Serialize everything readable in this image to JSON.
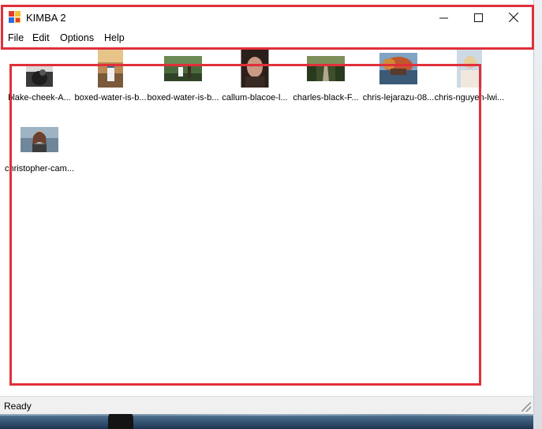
{
  "window": {
    "title": "KIMBA 2",
    "controls": {
      "minimize": "minimize-icon",
      "maximize": "maximize-icon",
      "close": "close-icon"
    }
  },
  "menu": {
    "items": [
      "File",
      "Edit",
      "Options",
      "Help"
    ]
  },
  "thumbnails": [
    {
      "caption": "blake-cheek-A..."
    },
    {
      "caption": "boxed-water-is-b..."
    },
    {
      "caption": "boxed-water-is-b..."
    },
    {
      "caption": "callum-blacoe-l..."
    },
    {
      "caption": "charles-black-F..."
    },
    {
      "caption": "chris-lejarazu-08..."
    },
    {
      "caption": "chris-nguyen-lwi..."
    },
    {
      "caption": "christopher-cam..."
    }
  ],
  "status": {
    "text": "Ready"
  },
  "colors": {
    "annotation": "#e0303a",
    "status_bg": "#f0f0f0"
  }
}
